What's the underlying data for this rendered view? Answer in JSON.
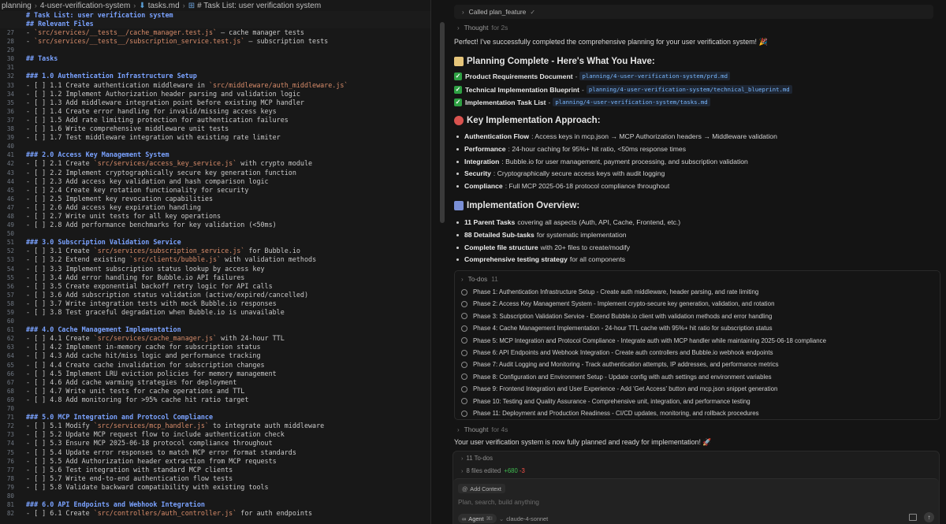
{
  "editor": {
    "breadcrumb": [
      "planning",
      "4-user-verification-system",
      "tasks.md",
      "# Task List: user verification system"
    ],
    "sticky": [
      {
        "text": "# Task List: user verification system",
        "kind": "heading"
      },
      {
        "text": "## Relevant Files",
        "kind": "heading"
      }
    ],
    "lines": [
      {
        "n": "27",
        "t": "- `src/services/__tests__/cache_manager.test.js` – cache manager tests"
      },
      {
        "n": "28",
        "t": "- `src/services/__tests__/subscription_service.test.js` – subscription tests"
      },
      {
        "n": "29",
        "t": ""
      },
      {
        "n": "30",
        "t": "## Tasks",
        "h": true
      },
      {
        "n": "31",
        "t": ""
      },
      {
        "n": "32",
        "t": "### 1.0 Authentication Infrastructure Setup",
        "h": true
      },
      {
        "n": "33",
        "t": "- [ ] 1.1 Create authentication middleware in `src/middleware/auth_middleware.js`"
      },
      {
        "n": "34",
        "t": "- [ ] 1.2 Implement Authorization header parsing and validation logic"
      },
      {
        "n": "35",
        "t": "- [ ] 1.3 Add middleware integration point before existing MCP handler"
      },
      {
        "n": "36",
        "t": "- [ ] 1.4 Create error handling for invalid/missing access keys"
      },
      {
        "n": "37",
        "t": "- [ ] 1.5 Add rate limiting protection for authentication failures"
      },
      {
        "n": "38",
        "t": "- [ ] 1.6 Write comprehensive middleware unit tests"
      },
      {
        "n": "39",
        "t": "- [ ] 1.7 Test middleware integration with existing rate limiter"
      },
      {
        "n": "40",
        "t": ""
      },
      {
        "n": "41",
        "t": "### 2.0 Access Key Management System",
        "h": true
      },
      {
        "n": "42",
        "t": "- [ ] 2.1 Create `src/services/access_key_service.js` with crypto module"
      },
      {
        "n": "43",
        "t": "- [ ] 2.2 Implement cryptographically secure key generation function"
      },
      {
        "n": "44",
        "t": "- [ ] 2.3 Add access key validation and hash comparison logic"
      },
      {
        "n": "45",
        "t": "- [ ] 2.4 Create key rotation functionality for security"
      },
      {
        "n": "46",
        "t": "- [ ] 2.5 Implement key revocation capabilities"
      },
      {
        "n": "47",
        "t": "- [ ] 2.6 Add access key expiration handling"
      },
      {
        "n": "48",
        "t": "- [ ] 2.7 Write unit tests for all key operations"
      },
      {
        "n": "49",
        "t": "- [ ] 2.8 Add performance benchmarks for key validation (<50ms)"
      },
      {
        "n": "50",
        "t": ""
      },
      {
        "n": "51",
        "t": "### 3.0 Subscription Validation Service",
        "h": true
      },
      {
        "n": "52",
        "t": "- [ ] 3.1 Create `src/services/subscription_service.js` for Bubble.io"
      },
      {
        "n": "53",
        "t": "- [ ] 3.2 Extend existing `src/clients/bubble.js` with validation methods"
      },
      {
        "n": "54",
        "t": "- [ ] 3.3 Implement subscription status lookup by access key"
      },
      {
        "n": "55",
        "t": "- [ ] 3.4 Add error handling for Bubble.io API failures"
      },
      {
        "n": "56",
        "t": "- [ ] 3.5 Create exponential backoff retry logic for API calls"
      },
      {
        "n": "57",
        "t": "- [ ] 3.6 Add subscription status validation (active/expired/cancelled)"
      },
      {
        "n": "58",
        "t": "- [ ] 3.7 Write integration tests with mock Bubble.io responses"
      },
      {
        "n": "59",
        "t": "- [ ] 3.8 Test graceful degradation when Bubble.io is unavailable"
      },
      {
        "n": "60",
        "t": ""
      },
      {
        "n": "61",
        "t": "### 4.0 Cache Management Implementation",
        "h": true
      },
      {
        "n": "62",
        "t": "- [ ] 4.1 Create `src/services/cache_manager.js` with 24-hour TTL"
      },
      {
        "n": "63",
        "t": "- [ ] 4.2 Implement in-memory cache for subscription status"
      },
      {
        "n": "64",
        "t": "- [ ] 4.3 Add cache hit/miss logic and performance tracking"
      },
      {
        "n": "65",
        "t": "- [ ] 4.4 Create cache invalidation for subscription changes"
      },
      {
        "n": "66",
        "t": "- [ ] 4.5 Implement LRU eviction policies for memory management"
      },
      {
        "n": "67",
        "t": "- [ ] 4.6 Add cache warming strategies for deployment"
      },
      {
        "n": "68",
        "t": "- [ ] 4.7 Write unit tests for cache operations and TTL"
      },
      {
        "n": "69",
        "t": "- [ ] 4.8 Add monitoring for >95% cache hit ratio target"
      },
      {
        "n": "70",
        "t": ""
      },
      {
        "n": "71",
        "t": "### 5.0 MCP Integration and Protocol Compliance",
        "h": true
      },
      {
        "n": "72",
        "t": "- [ ] 5.1 Modify `src/services/mcp_handler.js` to integrate auth middleware"
      },
      {
        "n": "73",
        "t": "- [ ] 5.2 Update MCP request flow to include authentication check"
      },
      {
        "n": "74",
        "t": "- [ ] 5.3 Ensure MCP 2025-06-18 protocol compliance throughout"
      },
      {
        "n": "75",
        "t": "- [ ] 5.4 Update error responses to match MCP error format standards"
      },
      {
        "n": "76",
        "t": "- [ ] 5.5 Add Authorization header extraction from MCP requests"
      },
      {
        "n": "77",
        "t": "- [ ] 5.6 Test integration with standard MCP clients"
      },
      {
        "n": "78",
        "t": "- [ ] 5.7 Write end-to-end authentication flow tests"
      },
      {
        "n": "79",
        "t": "- [ ] 5.8 Validate backward compatibility with existing tools"
      },
      {
        "n": "80",
        "t": ""
      },
      {
        "n": "81",
        "t": "### 6.0 API Endpoints and Webhook Integration",
        "h": true
      },
      {
        "n": "82",
        "t": "- [ ] 6.1 Create `src/controllers/auth_controller.js` for auth endpoints"
      }
    ]
  },
  "chat": {
    "tool_call": "Called plan_feature",
    "thought1": {
      "label": "Thought",
      "duration": "for 2s"
    },
    "intro": "Perfect! I've successfully completed the comprehensive planning for your user verification system! 🎉",
    "planning_heading": "Planning Complete - Here's What You Have:",
    "deliverables": [
      {
        "label": "Product Requirements Document",
        "path": "planning/4-user-verification-system/prd.md"
      },
      {
        "label": "Technical Implementation Blueprint",
        "path": "planning/4-user-verification-system/technical_blueprint.md"
      },
      {
        "label": "Implementation Task List",
        "path": "planning/4-user-verification-system/tasks.md"
      }
    ],
    "approach_heading": "Key Implementation Approach:",
    "approach": [
      {
        "b": "Authentication Flow",
        "t": ": Access keys in mcp.json → MCP Authorization headers → Middleware validation"
      },
      {
        "b": "Performance",
        "t": ": 24-hour caching for 95%+ hit ratio, <50ms response times"
      },
      {
        "b": "Integration",
        "t": ": Bubble.io for user management, payment processing, and subscription validation"
      },
      {
        "b": "Security",
        "t": ": Cryptographically secure access keys with audit logging"
      },
      {
        "b": "Compliance",
        "t": ": Full MCP 2025-06-18 protocol compliance throughout"
      }
    ],
    "overview_heading": "Implementation Overview:",
    "overview": [
      {
        "b": "11 Parent Tasks",
        "t": "covering all aspects (Auth, API, Cache, Frontend, etc.)"
      },
      {
        "b": "88 Detailed Sub-tasks",
        "t": "for systematic implementation"
      },
      {
        "b": "Complete file structure",
        "t": "with 20+ files to create/modify"
      },
      {
        "b": "Comprehensive testing strategy",
        "t": "for all components"
      }
    ],
    "todos": {
      "label": "To-dos",
      "count": "11",
      "items": [
        "Phase 1: Authentication Infrastructure Setup - Create auth middleware, header parsing, and rate limiting",
        "Phase 2: Access Key Management System - Implement crypto-secure key generation, validation, and rotation",
        "Phase 3: Subscription Validation Service - Extend Bubble.io client with validation methods and error handling",
        "Phase 4: Cache Management Implementation - 24-hour TTL cache with 95%+ hit ratio for subscription status",
        "Phase 5: MCP Integration and Protocol Compliance - Integrate auth with MCP handler while maintaining 2025-06-18 compliance",
        "Phase 6: API Endpoints and Webhook Integration - Create auth controllers and Bubble.io webhook endpoints",
        "Phase 7: Audit Logging and Monitoring - Track authentication attempts, IP addresses, and performance metrics",
        "Phase 8: Configuration and Environment Setup - Update config with auth settings and environment variables",
        "Phase 9: Frontend Integration and User Experience - Add 'Get Access' button and mcp.json snippet generation",
        "Phase 10: Testing and Quality Assurance - Comprehensive unit, integration, and performance testing",
        "Phase 11: Deployment and Production Readiness - CI/CD updates, monitoring, and rollback procedures"
      ]
    },
    "thought2": {
      "label": "Thought",
      "duration": "for 4s"
    },
    "final": "Your user verification system is now fully planned and ready for implementation! 🚀",
    "summary_todos": "11 To-dos",
    "files_edited": {
      "label": "8 files edited",
      "plus": "+680",
      "minus": "-3"
    },
    "composer": {
      "add_context": "Add Context",
      "placeholder": "Plan, search, build anything",
      "agent": "Agent",
      "agent_kbd": "⌘I",
      "model": "claude-4-sonnet"
    }
  },
  "colors": {
    "accent_blue": "#79b8ff",
    "heading_blue": "#7aa2ff",
    "check_green": "#2ea043",
    "diff_plus": "#3fb950",
    "diff_minus": "#f85149"
  }
}
